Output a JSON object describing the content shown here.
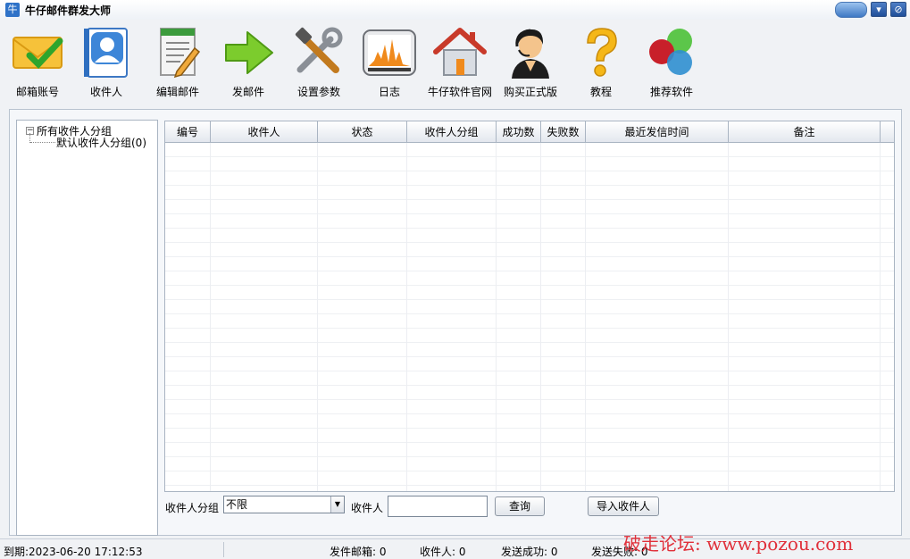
{
  "window": {
    "title": "牛仔邮件群发大师",
    "app_icon_glyph": "牛",
    "minimize_glyph": "▾",
    "close_glyph": "⊘"
  },
  "toolbar": {
    "items": [
      {
        "label": "邮箱账号",
        "icon": "envelope-check-icon"
      },
      {
        "label": "收件人",
        "icon": "contact-card-icon"
      },
      {
        "label": "编辑邮件",
        "icon": "edit-document-icon"
      },
      {
        "label": "发邮件",
        "icon": "green-arrow-icon"
      },
      {
        "label": "设置参数",
        "icon": "tools-icon"
      },
      {
        "label": "日志",
        "icon": "chart-log-icon"
      },
      {
        "label": "牛仔软件官网",
        "icon": "house-icon"
      },
      {
        "label": "购买正式版",
        "icon": "support-agent-icon"
      },
      {
        "label": "教程",
        "icon": "question-mark-icon"
      },
      {
        "label": "推荐软件",
        "icon": "color-circles-icon"
      }
    ]
  },
  "tree": {
    "root_label": "所有收件人分组",
    "root_toggle": "−",
    "children": [
      {
        "label": "默认收件人分组(0)"
      }
    ]
  },
  "grid": {
    "columns": [
      "编号",
      "收件人",
      "状态",
      "收件人分组",
      "成功数",
      "失败数",
      "最近发信时间",
      "备注"
    ],
    "rows": []
  },
  "filter": {
    "group_label": "收件人分组",
    "group_value": "不限",
    "group_arrow": "▼",
    "recipient_label": "收件人",
    "recipient_value": "",
    "query_button": "查询",
    "import_button": "导入收件人"
  },
  "status": {
    "expiry": "到期:2023-06-20 17:12:53",
    "sender_mailboxes": "发件邮箱: 0",
    "recipients": "收件人: 0",
    "send_success": "发送成功: 0",
    "send_failed": "发送失败: 0"
  },
  "watermark": "破走论坛: www.pozou.com",
  "colors": {
    "window_bg": "#f0f2f5",
    "grid_border": "#a9b4c2",
    "title_button": "#2e5fa8",
    "watermark": "#e0303a"
  }
}
